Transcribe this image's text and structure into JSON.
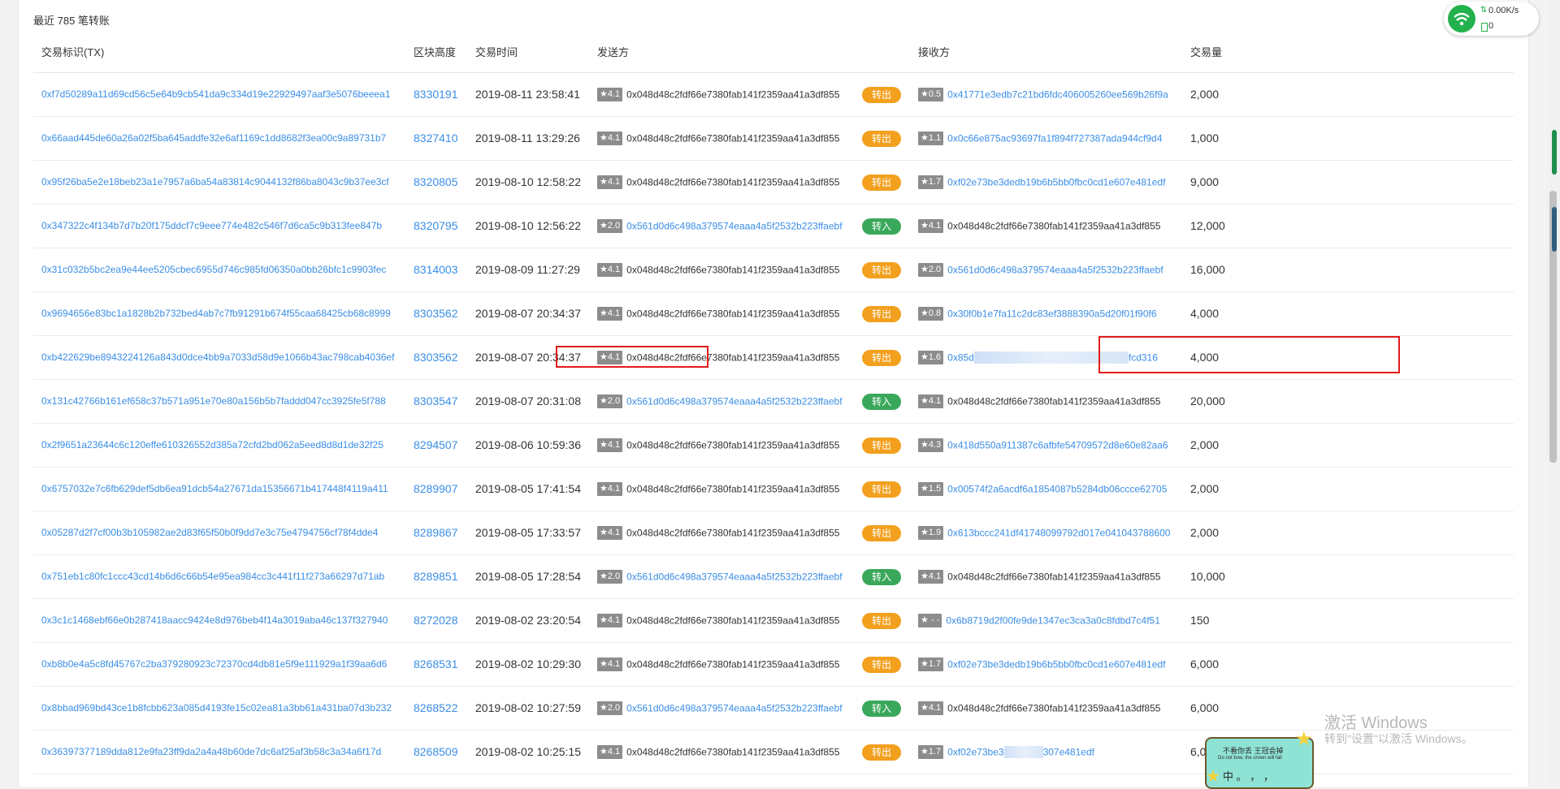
{
  "summary": "最近 785 笔转账",
  "columns": {
    "tx": "交易标识(TX)",
    "block": "区块高度",
    "time": "交易时间",
    "sender": "发送方",
    "receiver": "接收方",
    "amount": "交易量"
  },
  "colors": {
    "link": "#3a8ee6",
    "out": "#f2a01e",
    "in": "#3aa85b",
    "highlight": "#e21b1b"
  },
  "rows": [
    {
      "tx": "0xf7d50289a11d69cd56c5e64b9cb541da9c334d19e22929497aaf3e5076beeea1",
      "block": "8330191",
      "time": "2019-08-11 23:58:41",
      "from_score": "★4.1",
      "from": "0x048d48c2fdf66e7380fab141f2359aa41a3df855",
      "dir": "转出",
      "to_score": "★0.5",
      "to": "0x41771e3edb7c21bd6fdc406005260ee569b26f9a",
      "amount": "2,000"
    },
    {
      "tx": "0x66aad445de60a26a02f5ba645addfe32e6af1169c1dd8682f3ea00c9a89731b7",
      "block": "8327410",
      "time": "2019-08-11 13:29:26",
      "from_score": "★4.1",
      "from": "0x048d48c2fdf66e7380fab141f2359aa41a3df855",
      "dir": "转出",
      "to_score": "★1.1",
      "to": "0x0c66e875ac93697fa1f894f727387ada944cf9d4",
      "amount": "1,000"
    },
    {
      "tx": "0x95f26ba5e2e18beb23a1e7957a6ba54a83814c9044132f86ba8043c9b37ee3cf",
      "block": "8320805",
      "time": "2019-08-10 12:58:22",
      "from_score": "★4.1",
      "from": "0x048d48c2fdf66e7380fab141f2359aa41a3df855",
      "dir": "转出",
      "to_score": "★1.7",
      "to": "0xf02e73be3dedb19b6b5bb0fbc0cd1e607e481edf",
      "amount": "9,000"
    },
    {
      "tx": "0x347322c4f134b7d7b20f175ddcf7c9eee774e482c546f7d6ca5c9b313fee847b",
      "block": "8320795",
      "time": "2019-08-10 12:56:22",
      "from_score": "★2.0",
      "from": "0x561d0d6c498a379574eaaa4a5f2532b223ffaebf",
      "dir": "转入",
      "to_score": "★4.1",
      "to": "0x048d48c2fdf66e7380fab141f2359aa41a3df855",
      "amount": "12,000"
    },
    {
      "tx": "0x31c032b5bc2ea9e44ee5205cbec6955d746c985fd06350a0bb26bfc1c9903fec",
      "block": "8314003",
      "time": "2019-08-09 11:27:29",
      "from_score": "★4.1",
      "from": "0x048d48c2fdf66e7380fab141f2359aa41a3df855",
      "dir": "转出",
      "to_score": "★2.0",
      "to": "0x561d0d6c498a379574eaaa4a5f2532b223ffaebf",
      "amount": "16,000"
    },
    {
      "tx": "0x9694656e83bc1a1828b2b732bed4ab7c7fb91291b674f55caa68425cb68c8999",
      "block": "8303562",
      "time": "2019-08-07 20:34:37",
      "from_score": "★4.1",
      "from": "0x048d48c2fdf66e7380fab141f2359aa41a3df855",
      "dir": "转出",
      "to_score": "★0.8",
      "to": "0x30f0b1e7fa11c2dc83ef3888390a5d20f01f90f6",
      "amount": "4,000"
    },
    {
      "tx": "0xb422629be8943224126a843d0dce4bb9a7033d58d9e1066b43ac798cab4036ef",
      "block": "8303562",
      "time": "2019-08-07 20:34:37",
      "from_score": "★4.1",
      "from": "0x048d48c2fdf66e7380fab141f2359aa41a3df855",
      "dir": "转出",
      "to_score": "★1.6",
      "to": "0x85d",
      "to_tail": "fcd316",
      "amount": "4,000"
    },
    {
      "tx": "0x131c42766b161ef658c37b571a951e70e80a156b5b7faddd047cc3925fe5f788",
      "block": "8303547",
      "time": "2019-08-07 20:31:08",
      "from_score": "★2.0",
      "from": "0x561d0d6c498a379574eaaa4a5f2532b223ffaebf",
      "dir": "转入",
      "to_score": "★4.1",
      "to": "0x048d48c2fdf66e7380fab141f2359aa41a3df855",
      "amount": "20,000"
    },
    {
      "tx": "0x2f9651a23644c6c120effe610326552d385a72cfd2bd062a5eed8d8d1de32f25",
      "block": "8294507",
      "time": "2019-08-06 10:59:36",
      "from_score": "★4.1",
      "from": "0x048d48c2fdf66e7380fab141f2359aa41a3df855",
      "dir": "转出",
      "to_score": "★4.3",
      "to": "0x418d550a911387c6afbfe54709572d8e60e82aa6",
      "amount": "2,000"
    },
    {
      "tx": "0x6757032e7c6fb629def5db6ea91dcb54a27671da15356671b417448f4119a411",
      "block": "8289907",
      "time": "2019-08-05 17:41:54",
      "from_score": "★4.1",
      "from": "0x048d48c2fdf66e7380fab141f2359aa41a3df855",
      "dir": "转出",
      "to_score": "★1.5",
      "to": "0x00574f2a6acdf6a1854087b5284db06ccce62705",
      "amount": "2,000"
    },
    {
      "tx": "0x05287d2f7cf00b3b105982ae2d83f65f50b0f9dd7e3c75e4794756cf78f4dde4",
      "block": "8289867",
      "time": "2019-08-05 17:33:57",
      "from_score": "★4.1",
      "from": "0x048d48c2fdf66e7380fab141f2359aa41a3df855",
      "dir": "转出",
      "to_score": "★1.9",
      "to": "0x613bccc241df41748099792d017e041043788600",
      "amount": "2,000"
    },
    {
      "tx": "0x751eb1c80fc1ccc43cd14b6d6c66b54e95ea984cc3c441f11f273a66297d71ab",
      "block": "8289851",
      "time": "2019-08-05 17:28:54",
      "from_score": "★2.0",
      "from": "0x561d0d6c498a379574eaaa4a5f2532b223ffaebf",
      "dir": "转入",
      "to_score": "★4.1",
      "to": "0x048d48c2fdf66e7380fab141f2359aa41a3df855",
      "amount": "10,000"
    },
    {
      "tx": "0x3c1c1468ebf66e0b287418aacc9424e8d976beb4f14a3019aba46c137f327940",
      "block": "8272028",
      "time": "2019-08-02 23:20:54",
      "from_score": "★4.1",
      "from": "0x048d48c2fdf66e7380fab141f2359aa41a3df855",
      "dir": "转出",
      "to_score": "★ - -",
      "to": "0x6b8719d2f00fe9de1347ec3ca3a0c8fdbd7c4f51",
      "amount": "150"
    },
    {
      "tx": "0xb8b0e4a5c8fd45767c2ba379280923c72370cd4db81e5f9e111929a1f39aa6d6",
      "block": "8268531",
      "time": "2019-08-02 10:29:30",
      "from_score": "★4.1",
      "from": "0x048d48c2fdf66e7380fab141f2359aa41a3df855",
      "dir": "转出",
      "to_score": "★1.7",
      "to": "0xf02e73be3dedb19b6b5bb0fbc0cd1e607e481edf",
      "amount": "6,000"
    },
    {
      "tx": "0x8bbad969bd43ce1b8fcbb623a085d4193fe15c02ea81a3bb61a431ba07d3b232",
      "block": "8268522",
      "time": "2019-08-02 10:27:59",
      "from_score": "★2.0",
      "from": "0x561d0d6c498a379574eaaa4a5f2532b223ffaebf",
      "dir": "转入",
      "to_score": "★4.1",
      "to": "0x048d48c2fdf66e7380fab141f2359aa41a3df855",
      "amount": "6,000"
    },
    {
      "tx": "0x36397377189dda812e9fa23ff9da2a4a48b60de7dc6af25af3b58c3a34a6f17d",
      "block": "8268509",
      "time": "2019-08-02 10:25:15",
      "from_score": "★4.1",
      "from": "0x048d48c2fdf66e7380fab141f2359aa41a3df855",
      "dir": "转出",
      "to_score": "★1.7",
      "to": "0xf02e73be3",
      "to_tail": "307e481edf",
      "amount": "6,000"
    }
  ],
  "net_widget": {
    "speed": "0.00K/s",
    "count": "0"
  },
  "watermark": {
    "line1": "激活 Windows",
    "line2": "转到\"设置\"以激活 Windows。"
  },
  "sticker": {
    "line1": "不看你丢  王冠会掉",
    "line2": "Do not bow, the crown will fall",
    "line3": "中 。 ， ，"
  }
}
